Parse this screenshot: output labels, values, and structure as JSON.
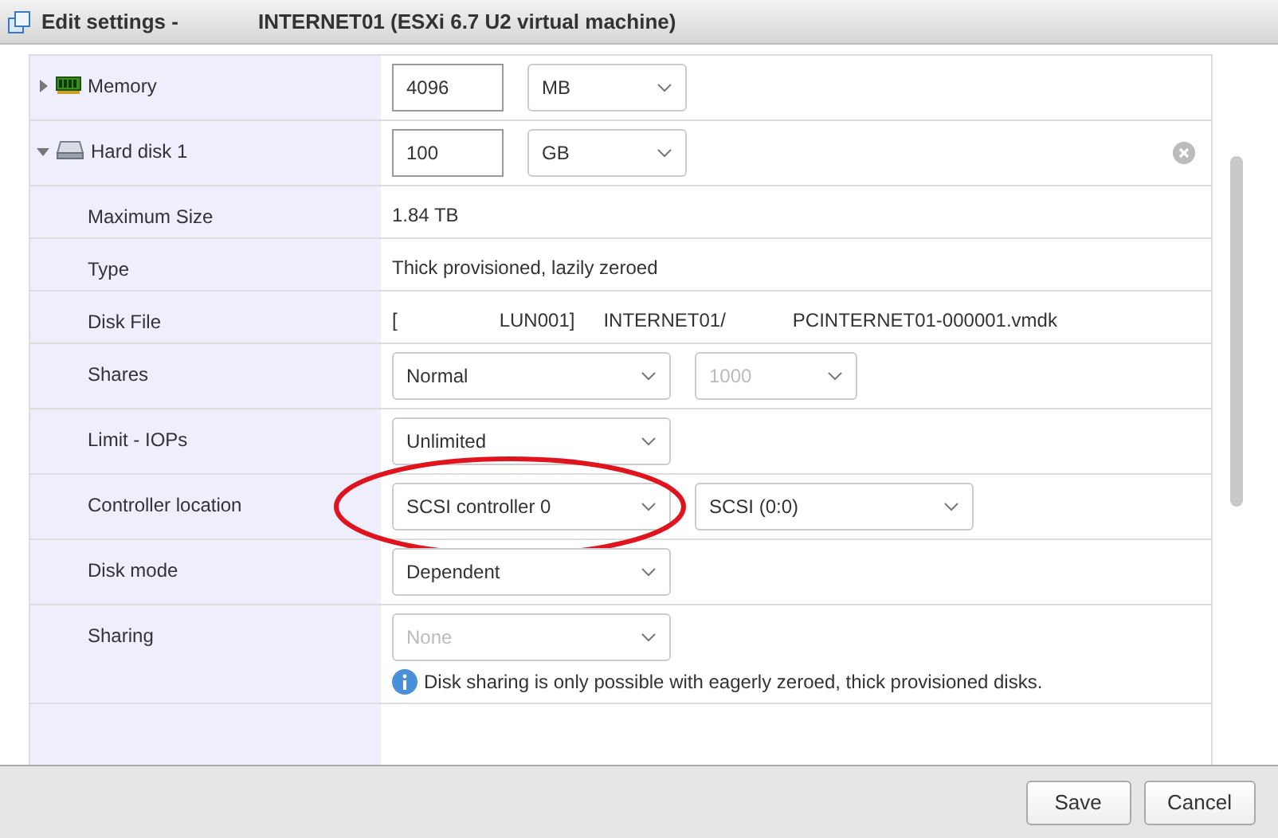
{
  "window": {
    "title_prefix": "Edit settings -",
    "title_name": "INTERNET01 (ESXi 6.7 U2 virtual machine)"
  },
  "rows": [
    {
      "kind": "memory",
      "label": "Memory",
      "expanded": false,
      "value": "4096",
      "unit": "MB"
    },
    {
      "kind": "disk",
      "label": "Hard disk 1",
      "expanded": true,
      "value": "100",
      "unit": "GB"
    },
    {
      "kind": "text",
      "label": "Maximum Size",
      "value": "1.84 TB"
    },
    {
      "kind": "text",
      "label": "Type",
      "value": "Thick provisioned, lazily zeroed"
    },
    {
      "kind": "parts",
      "label": "Disk File",
      "parts": [
        "[",
        "LUN001]",
        "INTERNET01/",
        "PCINTERNET01-000001.vmdk"
      ]
    },
    {
      "kind": "selects",
      "label": "Shares",
      "selects": [
        {
          "value": "Normal",
          "disabled": false
        },
        {
          "value": "1000",
          "disabled": true
        }
      ]
    },
    {
      "kind": "selects",
      "label": "Limit - IOPs",
      "selects": [
        {
          "value": "Unlimited",
          "disabled": false
        }
      ]
    },
    {
      "kind": "selects",
      "label": "Controller location",
      "circled": true,
      "selects": [
        {
          "value": "SCSI controller 0",
          "disabled": false
        },
        {
          "value": "SCSI (0:0)",
          "disabled": false
        }
      ]
    },
    {
      "kind": "selects",
      "label": "Disk mode",
      "selects": [
        {
          "value": "Dependent",
          "disabled": false
        }
      ]
    },
    {
      "kind": "selects",
      "label": "Sharing",
      "selects": [
        {
          "value": "None",
          "disabled": true
        }
      ],
      "note": "Disk sharing is only possible with eagerly zeroed, thick provisioned disks."
    }
  ],
  "buttons": [
    "Save",
    "Cancel"
  ]
}
